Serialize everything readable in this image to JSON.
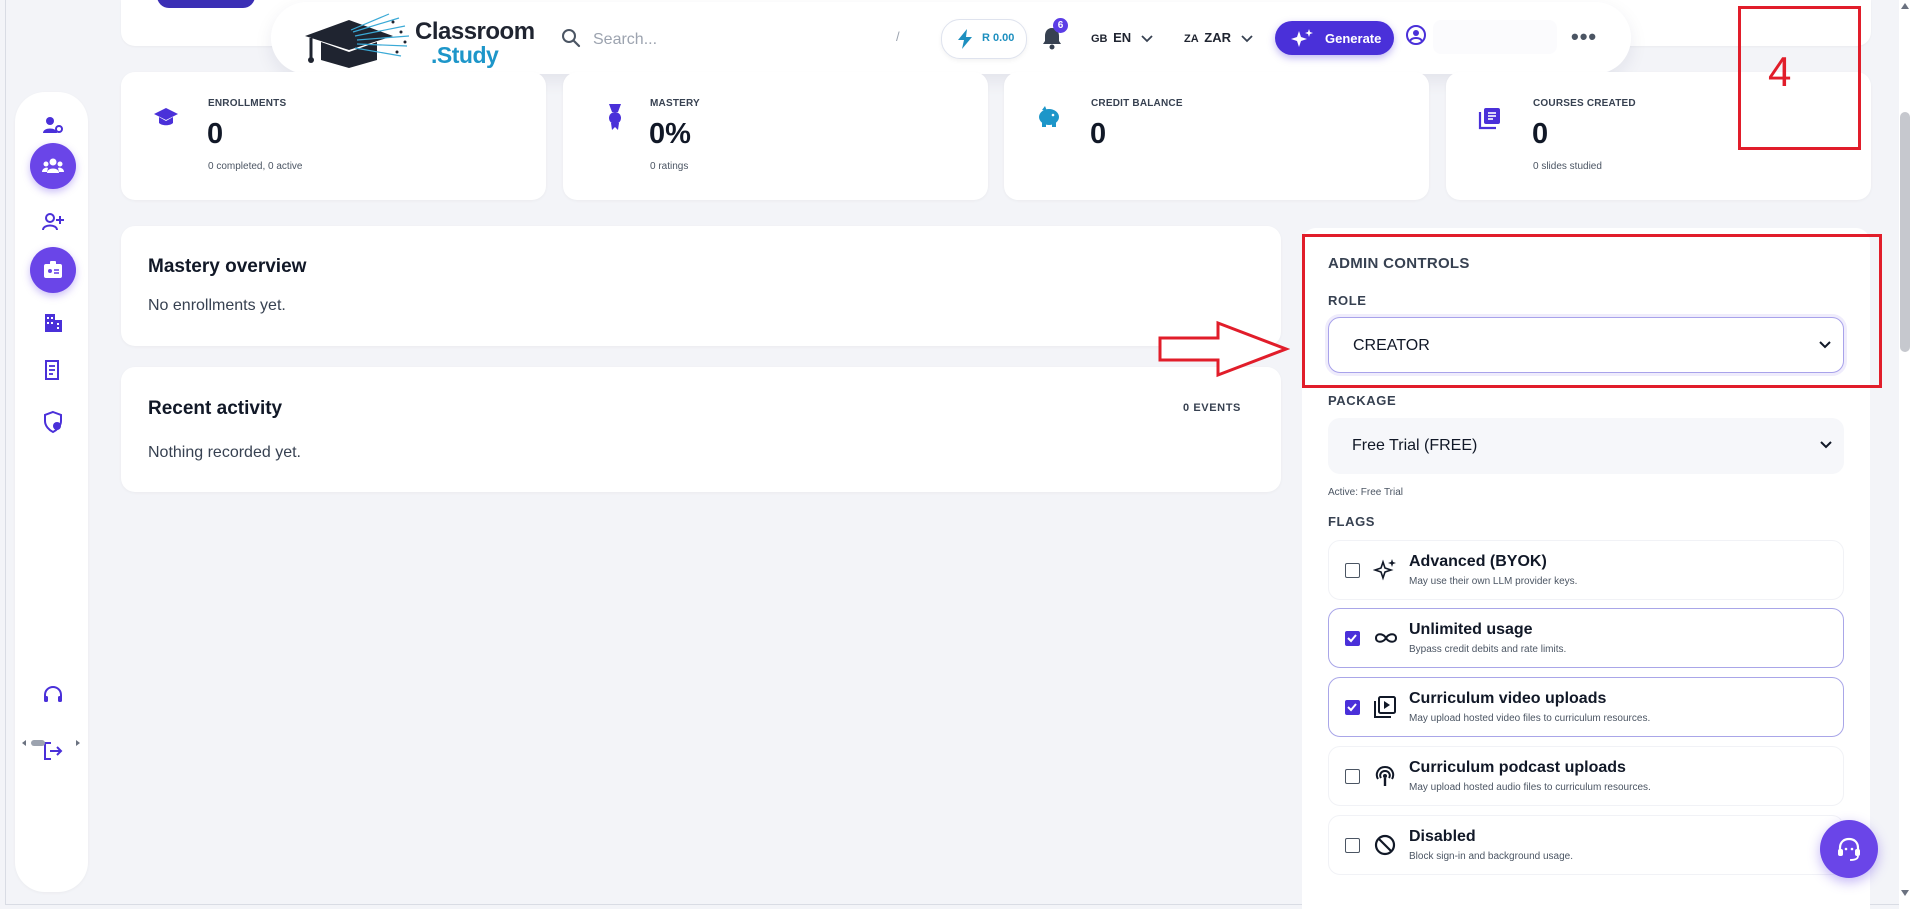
{
  "header": {
    "logo_line1": "Classroom",
    "logo_line2": ".Study",
    "search_placeholder": "Search...",
    "search_shortcut": "/",
    "credit": "R 0.00",
    "notifications_count": "6",
    "language_flag": "GB",
    "language": "EN",
    "currency_flag": "ZA",
    "currency": "ZAR",
    "generate_label": "Generate",
    "more_label": "•••"
  },
  "sidebar": {
    "items": [
      {
        "icon": "user-settings-icon",
        "active": false
      },
      {
        "icon": "users-group-icon",
        "active": true
      },
      {
        "icon": "user-add-icon",
        "active": false
      },
      {
        "icon": "id-badge-icon",
        "active": true
      },
      {
        "icon": "building-icon",
        "active": false
      },
      {
        "icon": "document-icon",
        "active": false
      },
      {
        "icon": "shield-icon",
        "active": false
      },
      {
        "icon": "support-icon",
        "active": false
      },
      {
        "icon": "logout-icon",
        "active": false
      }
    ]
  },
  "stats": [
    {
      "label": "ENROLLMENTS",
      "value": "0",
      "sub": "0 completed, 0 active",
      "icon": "graduation-cap-icon"
    },
    {
      "label": "MASTERY",
      "value": "0%",
      "sub": "0 ratings",
      "icon": "medal-icon"
    },
    {
      "label": "CREDIT BALANCE",
      "value": "0",
      "sub": "",
      "icon": "piggy-bank-icon"
    },
    {
      "label": "COURSES CREATED",
      "value": "0",
      "sub": "0 slides studied",
      "icon": "library-icon"
    }
  ],
  "mastery": {
    "title": "Mastery overview",
    "empty": "No enrollments yet."
  },
  "activity": {
    "title": "Recent activity",
    "events": "0 EVENTS",
    "empty": "Nothing recorded yet."
  },
  "admin": {
    "title": "ADMIN CONTROLS",
    "role_label": "ROLE",
    "role_value": "CREATOR",
    "package_label": "PACKAGE",
    "package_value": "Free Trial (FREE)",
    "package_active": "Active: Free Trial",
    "flags_label": "FLAGS",
    "flags": [
      {
        "title": "Advanced (BYOK)",
        "desc": "May use their own LLM provider keys.",
        "checked": false,
        "icon": "sparkles-icon"
      },
      {
        "title": "Unlimited usage",
        "desc": "Bypass credit debits and rate limits.",
        "checked": true,
        "icon": "infinity-icon"
      },
      {
        "title": "Curriculum video uploads",
        "desc": "May upload hosted video files to curriculum resources.",
        "checked": true,
        "icon": "video-library-icon"
      },
      {
        "title": "Curriculum podcast uploads",
        "desc": "May upload hosted audio files to curriculum resources.",
        "checked": false,
        "icon": "podcast-icon"
      },
      {
        "title": "Disabled",
        "desc": "Block sign-in and background usage.",
        "checked": false,
        "icon": "block-icon"
      }
    ]
  },
  "annotation": {
    "step_number": "4",
    "color": "#e11d2a"
  },
  "colors": {
    "accent": "#4a30d9",
    "sidebar_active": "#6a45e8",
    "brand_blue": "#1d96c9"
  }
}
